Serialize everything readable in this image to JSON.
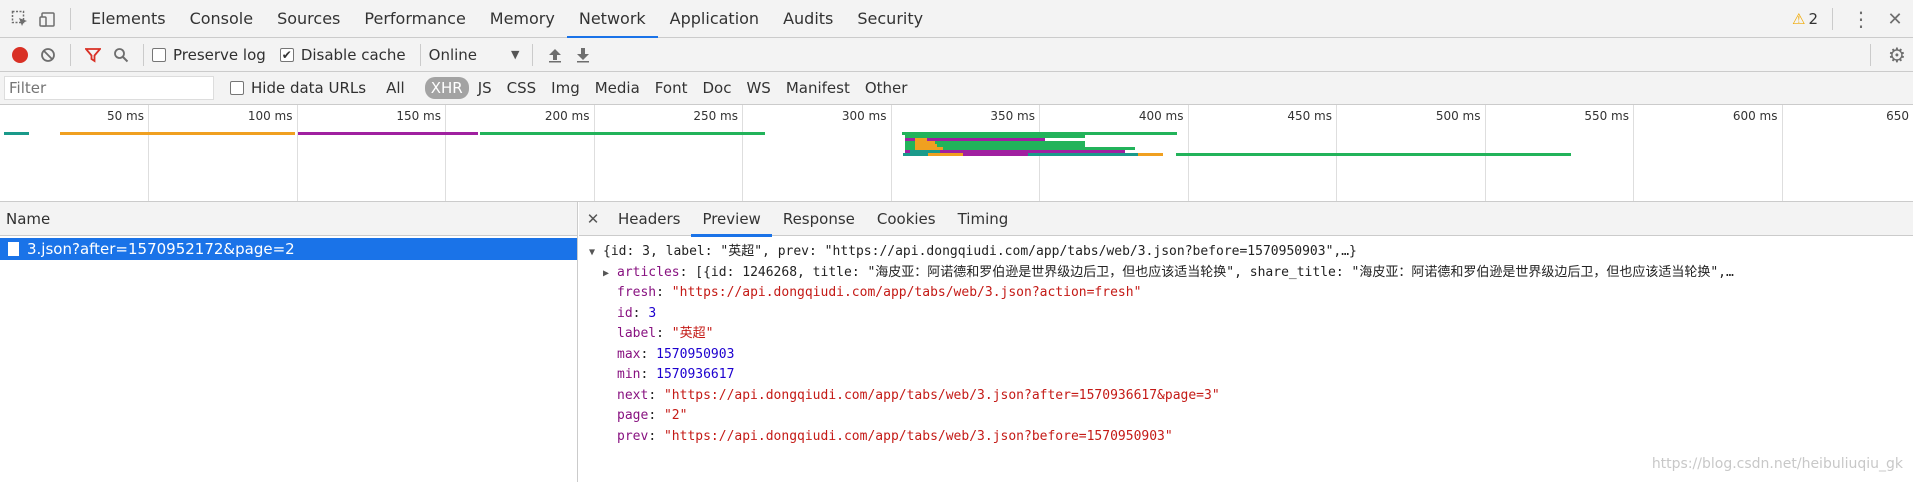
{
  "tabs": {
    "items": [
      {
        "label": "Elements"
      },
      {
        "label": "Console"
      },
      {
        "label": "Sources"
      },
      {
        "label": "Performance"
      },
      {
        "label": "Memory"
      },
      {
        "label": "Network"
      },
      {
        "label": "Application"
      },
      {
        "label": "Audits"
      },
      {
        "label": "Security"
      }
    ],
    "active": "Network",
    "warning_count": "2"
  },
  "toolbar": {
    "preserve_log": "Preserve log",
    "preserve_log_checked": false,
    "disable_cache": "Disable cache",
    "disable_cache_checked": true,
    "throttling": "Online"
  },
  "filterbar": {
    "placeholder": "Filter",
    "hide_data_urls": "Hide data URLs",
    "types": [
      "All",
      "XHR",
      "JS",
      "CSS",
      "Img",
      "Media",
      "Font",
      "Doc",
      "WS",
      "Manifest",
      "Other"
    ],
    "active_type": "XHR"
  },
  "timeline": {
    "ticks": [
      "50 ms",
      "100 ms",
      "150 ms",
      "200 ms",
      "250 ms",
      "300 ms",
      "350 ms",
      "400 ms",
      "450 ms",
      "500 ms",
      "550 ms",
      "600 ms",
      "650"
    ]
  },
  "requests": {
    "header": "Name",
    "items": [
      {
        "name": "3.json?after=1570952172&page=2",
        "selected": true
      }
    ]
  },
  "detail": {
    "tabs": [
      "Headers",
      "Preview",
      "Response",
      "Cookies",
      "Timing"
    ],
    "active": "Preview",
    "preview": {
      "summary": "{id: 3, label: \"英超\", prev: \"https://api.dongqiudi.com/app/tabs/web/3.json?before=1570950903\",…}",
      "articles_key": "articles",
      "articles_value": "[{id: 1246268, title: \"海皮亚：阿诺德和罗伯逊是世界级边后卫，但也应该适当轮换\", share_title: \"海皮亚：阿诺德和罗伯逊是世界级边后卫，但也应该适当轮换\",…",
      "fields": [
        {
          "key": "fresh",
          "value": "\"https://api.dongqiudi.com/app/tabs/web/3.json?action=fresh\"",
          "kind": "string"
        },
        {
          "key": "id",
          "value": "3",
          "kind": "number"
        },
        {
          "key": "label",
          "value": "\"英超\"",
          "kind": "string"
        },
        {
          "key": "max",
          "value": "1570950903",
          "kind": "number"
        },
        {
          "key": "min",
          "value": "1570936617",
          "kind": "number"
        },
        {
          "key": "next",
          "value": "\"https://api.dongqiudi.com/app/tabs/web/3.json?after=1570936617&page=3\"",
          "kind": "string"
        },
        {
          "key": "page",
          "value": "\"2\"",
          "kind": "string"
        },
        {
          "key": "prev",
          "value": "\"https://api.dongqiudi.com/app/tabs/web/3.json?before=1570950903\"",
          "kind": "string"
        }
      ]
    }
  },
  "watermark": "https://blog.csdn.net/heibuliuqiu_gk",
  "colors": {
    "accent": "#1a73e8",
    "record": "#d93025",
    "warning": "#f0a800",
    "json_key": "#881280",
    "json_string": "#c41a16",
    "json_number": "#1c00cf"
  }
}
